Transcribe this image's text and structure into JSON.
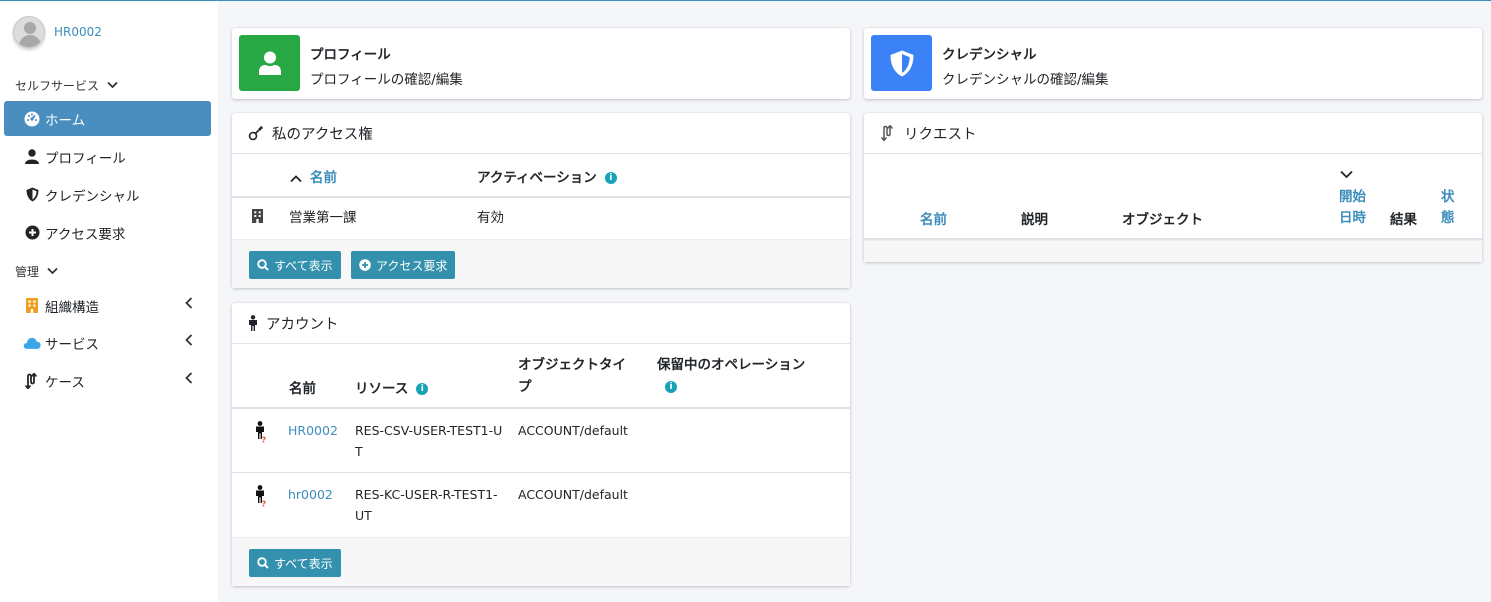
{
  "user": {
    "name": "HR0002"
  },
  "sidebar": {
    "selfservice_header": "セルフサービス",
    "admin_header": "管理",
    "items": [
      {
        "label": "ホーム"
      },
      {
        "label": "プロフィール"
      },
      {
        "label": "クレデンシャル"
      },
      {
        "label": "アクセス要求"
      }
    ],
    "admin_items": [
      {
        "label": "組織構造"
      },
      {
        "label": "サービス"
      },
      {
        "label": "ケース"
      }
    ]
  },
  "profile_box": {
    "title": "プロフィール",
    "subtitle": "プロフィールの確認/編集"
  },
  "credential_box": {
    "title": "クレデンシャル",
    "subtitle": "クレデンシャルの確認/編集"
  },
  "access": {
    "title": "私のアクセス権",
    "col_name": "名前",
    "col_activation": "アクティベーション",
    "rows": [
      {
        "name": "営業第一課",
        "activation": "有効"
      }
    ],
    "show_all": "すべて表示",
    "request_access": "アクセス要求"
  },
  "requests": {
    "title": "リクエスト",
    "col_name": "名前",
    "col_desc": "説明",
    "col_object": "オブジェクト",
    "col_start_1": "開始",
    "col_start_2": "日時",
    "col_result": "結果",
    "col_status_1": "状",
    "col_status_2": "態"
  },
  "accounts": {
    "title": "アカウント",
    "col_name": "名前",
    "col_resource": "リソース",
    "col_objtype_1": "オブジェクトタイ",
    "col_objtype_2": "プ",
    "col_pending": "保留中のオペレーション",
    "rows": [
      {
        "name": "HR0002",
        "resource_1": "RES-CSV-USER-TEST1-U",
        "resource_2": "T",
        "type": "ACCOUNT/default"
      },
      {
        "name": "hr0002",
        "resource_1": "RES-KC-USER-R-TEST1-",
        "resource_2": "UT",
        "type": "ACCOUNT/default"
      }
    ],
    "show_all": "すべて表示"
  },
  "colors": {
    "accent": "#3c8dbc",
    "active": "#4a8ec0",
    "profile": "#28a745",
    "credential": "#3b82f6",
    "button": "#3391ad",
    "info": "#17a2b8",
    "building": "#f0a020",
    "cloud": "#3aa6e8"
  }
}
